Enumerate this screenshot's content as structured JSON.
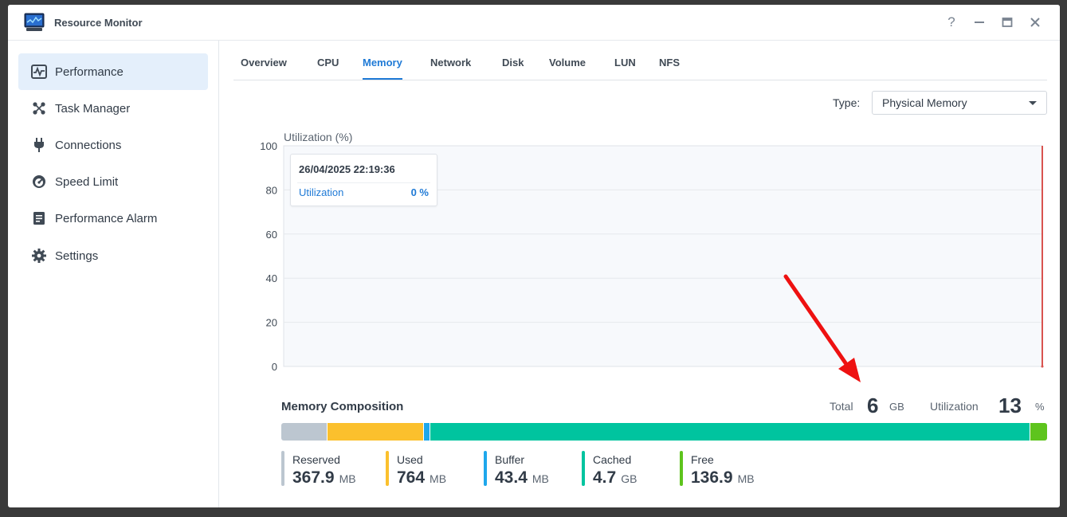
{
  "window": {
    "title": "Resource Monitor",
    "controls": [
      "?",
      "minimize",
      "maximize",
      "close"
    ]
  },
  "sidebar": {
    "items": [
      {
        "label": "Performance",
        "icon": "performance-icon",
        "active": true
      },
      {
        "label": "Task Manager",
        "icon": "task-manager-icon",
        "active": false
      },
      {
        "label": "Connections",
        "icon": "plug-icon",
        "active": false
      },
      {
        "label": "Speed Limit",
        "icon": "speedometer-icon",
        "active": false
      },
      {
        "label": "Performance Alarm",
        "icon": "alarm-clipboard-icon",
        "active": false
      },
      {
        "label": "Settings",
        "icon": "gear-icon",
        "active": false
      }
    ]
  },
  "tabs": [
    {
      "label": "Overview",
      "active": false
    },
    {
      "label": "CPU",
      "active": false
    },
    {
      "label": "Memory",
      "active": true
    },
    {
      "label": "Network",
      "active": false
    },
    {
      "label": "Disk",
      "active": false
    },
    {
      "label": "Volume",
      "active": false
    },
    {
      "label": "LUN",
      "active": false
    },
    {
      "label": "NFS",
      "active": false
    }
  ],
  "type_selector": {
    "label": "Type:",
    "value": "Physical Memory"
  },
  "chart_data": {
    "type": "line",
    "ylabel": "Utilization (%)",
    "ylim": [
      0,
      100
    ],
    "yticks": [
      "100",
      "80",
      "60",
      "40",
      "20",
      "0"
    ],
    "grid": true,
    "series": [
      {
        "name": "Utilization",
        "values": [
          0
        ]
      }
    ],
    "tooltip": {
      "time": "26/04/2025 22:19:36",
      "label": "Utilization",
      "value": "0 %"
    }
  },
  "composition": {
    "title": "Memory Composition",
    "total_label": "Total",
    "total_value": "6",
    "total_unit": "GB",
    "util_label": "Utilization",
    "util_value": "13",
    "util_unit": "%",
    "segments": [
      {
        "name": "Reserved",
        "value": "367.9",
        "unit": "MB",
        "color": "#bcc6d0",
        "fraction": 0.0599
      },
      {
        "name": "Used",
        "value": "764",
        "unit": "MB",
        "color": "#fbc02d",
        "fraction": 0.1244
      },
      {
        "name": "Buffer",
        "value": "43.4",
        "unit": "MB",
        "color": "#1ea7ec",
        "fraction": 0.0071
      },
      {
        "name": "Cached",
        "value": "4.7",
        "unit": "GB",
        "color": "#00c49f",
        "fraction": 0.7834
      },
      {
        "name": "Free",
        "value": "136.9",
        "unit": "MB",
        "color": "#5ec41d",
        "fraction": 0.0223
      }
    ]
  },
  "colors": {
    "accent": "#1f7ad6",
    "sidebar_active": "#e4effb",
    "chart_line": "#d9534f",
    "annotation_arrow": "#ee1111"
  }
}
